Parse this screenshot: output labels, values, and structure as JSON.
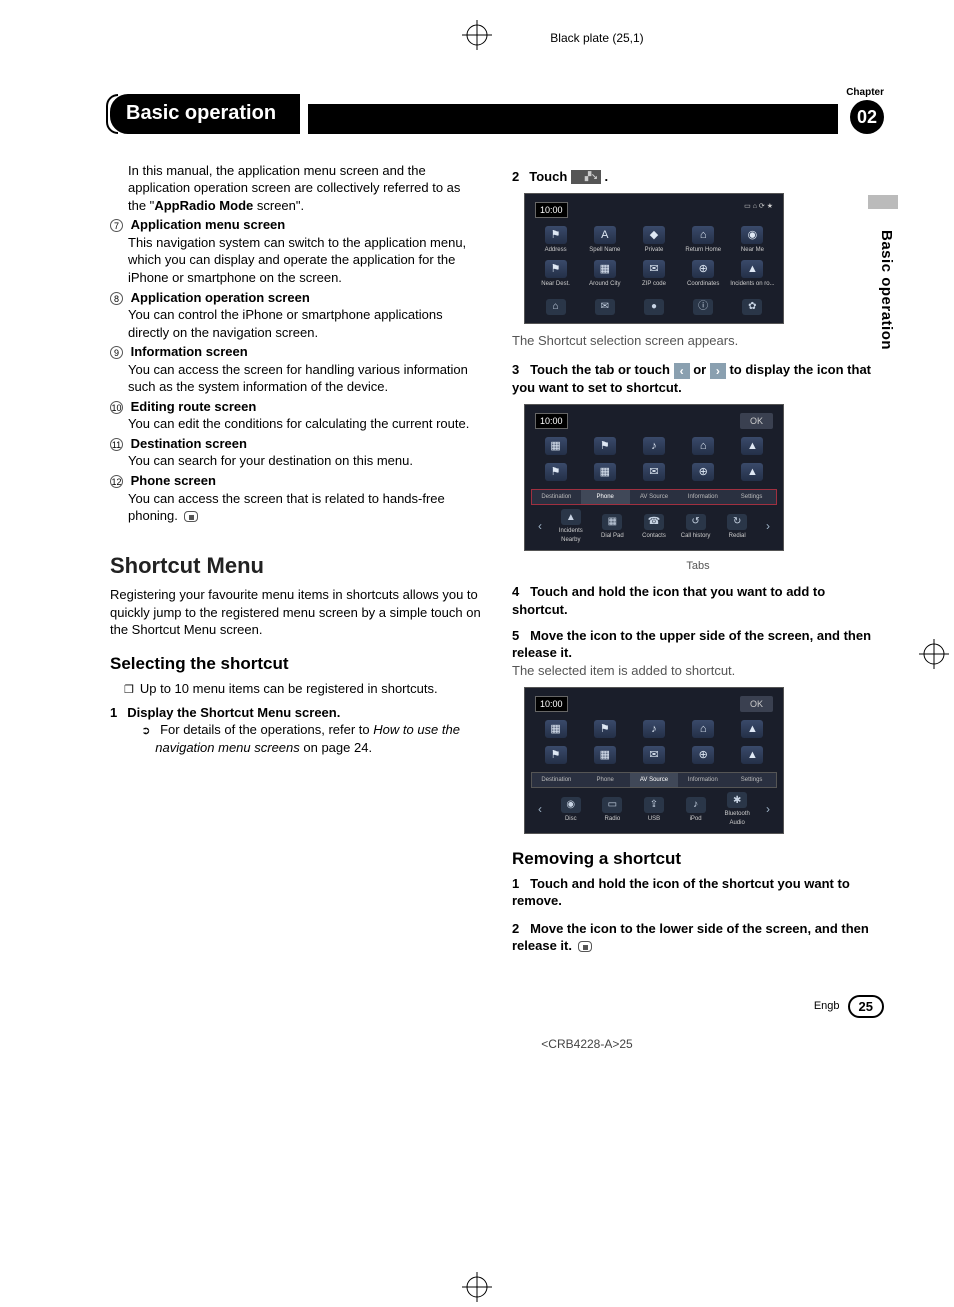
{
  "meta": {
    "plate": "Black plate (25,1)",
    "chapter_label": "Chapter",
    "chapter_num": "02",
    "title": "Basic operation",
    "side_tab": "Basic operation",
    "footer_lang": "Engb",
    "footer_page": "25",
    "doc_code": "<CRB4228-A>25"
  },
  "left": {
    "intro": "In this manual, the application menu screen and the application operation screen are collectively referred to as the \"",
    "intro_bold": "AppRadio Mode",
    "intro_tail": " screen\".",
    "items": [
      {
        "n": "7",
        "title": "Application menu screen",
        "body": "This navigation system can switch to the application menu, which you can display and operate the application for the iPhone or smartphone on the screen."
      },
      {
        "n": "8",
        "title": "Application operation screen",
        "body": "You can control the iPhone or smartphone applications directly on the navigation screen."
      },
      {
        "n": "9",
        "title": "Information screen",
        "body": "You can access the screen for handling various information such as the system information of the device."
      },
      {
        "n": "10",
        "title": "Editing route screen",
        "body": "You can edit the conditions for calculating the current route."
      },
      {
        "n": "11",
        "title": "Destination screen",
        "body": "You can search for your destination on this menu."
      },
      {
        "n": "12",
        "title": "Phone screen",
        "body": "You can access the screen that is related to hands-free phoning."
      }
    ],
    "shortcut_heading": "Shortcut Menu",
    "shortcut_intro": "Registering your favourite menu items in shortcuts allows you to quickly jump to the registered menu screen by a simple touch on the Shortcut Menu screen.",
    "selecting_heading": "Selecting the shortcut",
    "note_bullet": "Up to 10 menu items can be registered in shortcuts.",
    "step1_num": "1",
    "step1_title": "Display the Shortcut Menu screen.",
    "step1_ref_a": "For details of the operations, refer to ",
    "step1_ref_it": "How to use the navigation menu screens",
    "step1_ref_b": " on page 24."
  },
  "right": {
    "step2_num": "2",
    "step2_label": "Touch ",
    "step2_tail": ".",
    "scr1": {
      "time": "10:00",
      "row1": [
        "Address",
        "Spell Name",
        "Private",
        "Return Home",
        "Near Me"
      ],
      "row2": [
        "Near Dest.",
        "Around City",
        "ZIP code",
        "Coordinates",
        "Incidents on ro..."
      ],
      "bottom_icons": [
        "⌂",
        "✉",
        "●",
        "ⓘ",
        "✿"
      ]
    },
    "scr1_caption": "The Shortcut selection screen appears.",
    "step3_num": "3",
    "step3_a": "Touch the tab or touch ",
    "step3_b": " or ",
    "step3_c": " to display the icon that you want to set to shortcut.",
    "scr2": {
      "time": "10:00",
      "ok": "OK",
      "tabs": [
        "Destination",
        "Phone",
        "AV Source",
        "Information",
        "Settings"
      ],
      "bottom": [
        "Incidents Nearby",
        "Dial Pad",
        "Contacts",
        "Call history",
        "Redial"
      ],
      "caption": "Tabs"
    },
    "step4_num": "4",
    "step4": "Touch and hold the icon that you want to add to shortcut.",
    "step5_num": "5",
    "step5": "Move the icon to the upper side of the screen, and then release it.",
    "step5_note": "The selected item is added to shortcut.",
    "scr3": {
      "time": "10:00",
      "ok": "OK",
      "tabs": [
        "Destination",
        "Phone",
        "AV Source",
        "Information",
        "Settings"
      ],
      "bottom": [
        "Disc",
        "Radio",
        "USB",
        "iPod",
        "Bluetooth Audio"
      ]
    },
    "removing_heading": "Removing a shortcut",
    "rstep1_num": "1",
    "rstep1": "Touch and hold the icon of the shortcut you want to remove.",
    "rstep2_num": "2",
    "rstep2": "Move the icon to the lower side of the screen, and then release it."
  }
}
